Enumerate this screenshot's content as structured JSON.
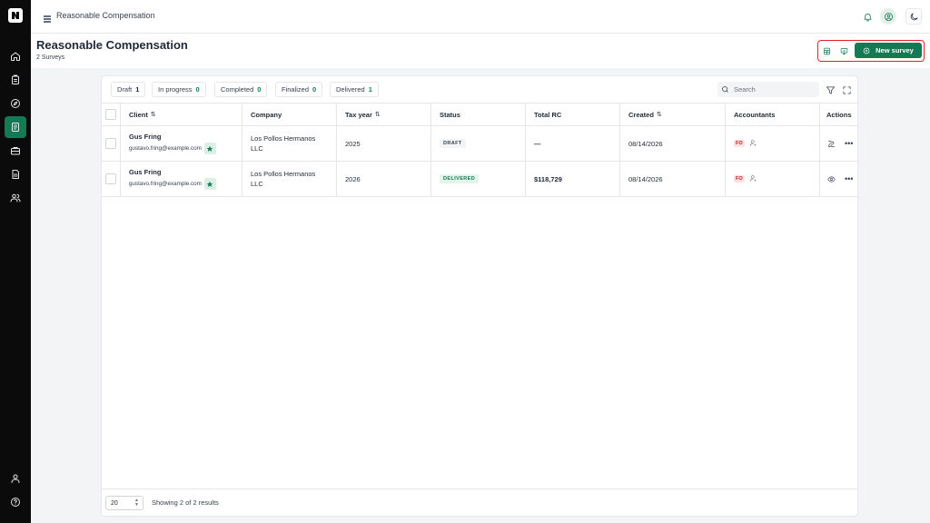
{
  "app": {
    "title": "Reasonable Compensation"
  },
  "sidebar": {
    "items": [
      {
        "icon": "home-icon"
      },
      {
        "icon": "clipboard-icon"
      },
      {
        "icon": "compass-icon"
      },
      {
        "icon": "survey-icon",
        "active": true
      },
      {
        "icon": "briefcase-icon"
      },
      {
        "icon": "document-icon"
      },
      {
        "icon": "users-icon"
      }
    ],
    "bottom": [
      {
        "icon": "user-icon"
      },
      {
        "icon": "help-icon"
      }
    ]
  },
  "page": {
    "title": "Reasonable Compensation",
    "subtitle": "2 Surveys",
    "new_button": "New survey"
  },
  "filters": [
    {
      "label": "Draft",
      "count": "1"
    },
    {
      "label": "In progress",
      "count": "0"
    },
    {
      "label": "Completed",
      "count": "0"
    },
    {
      "label": "Finalized",
      "count": "0"
    },
    {
      "label": "Delivered",
      "count": "1"
    }
  ],
  "search": {
    "placeholder": "Search"
  },
  "table": {
    "headers": {
      "client": "Client",
      "company": "Company",
      "tax_year": "Tax year",
      "status": "Status",
      "total_rc": "Total RC",
      "created": "Created",
      "accountants": "Accountants",
      "actions": "Actions"
    },
    "rows": [
      {
        "client": "Gus Fring",
        "email": "gustavo.fring@example.com",
        "company_line1": "Los Pollos Hermanos",
        "company_line2": "LLC",
        "tax_year": "2025",
        "status": "DRAFT",
        "total_rc": "—",
        "created": "08/14/2026",
        "accountant": "FO"
      },
      {
        "client": "Gus Fring",
        "email": "gustavo.fring@example.com",
        "company_line1": "Los Pollos Hermanos",
        "company_line2": "LLC",
        "tax_year": "2026",
        "status": "DELIVERED",
        "total_rc": "$118,729",
        "created": "08/14/2026",
        "accountant": "FO"
      }
    ]
  },
  "footer": {
    "page_size": "20",
    "showing": "Showing 2 of 2 results"
  },
  "colors": {
    "accent": "#137a55",
    "sidebar": "#0b0b0b",
    "highlight_border": "#dc2626"
  }
}
